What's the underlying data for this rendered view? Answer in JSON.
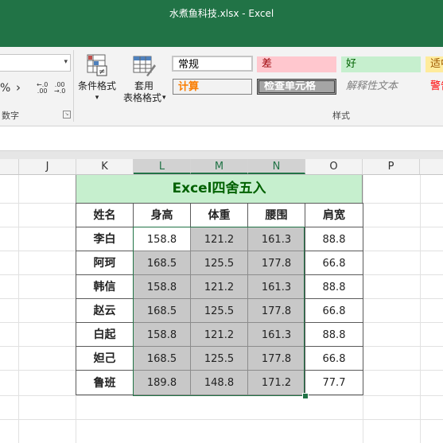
{
  "window": {
    "title": "水煮鱼科技.xlsx - Excel"
  },
  "ribbon": {
    "number_group": {
      "label": "数字",
      "percent": "%",
      "comma": "›",
      "inc_decimal": [
        "←.0",
        ".00"
      ],
      "dec_decimal": [
        ".00",
        "→.0"
      ]
    },
    "conditional_format": {
      "label": "条件格式",
      "arrow": "▾"
    },
    "table_format": {
      "label_line1": "套用",
      "label_line2": "表格格式",
      "arrow": "▾"
    },
    "styles_group": {
      "label": "样式",
      "cells": [
        {
          "name": "normal",
          "label": "常规",
          "fg": "#000000",
          "bg": "#ffffff"
        },
        {
          "name": "bad",
          "label": "差",
          "fg": "#9c0006",
          "bg": "#ffc7ce"
        },
        {
          "name": "good",
          "label": "好",
          "fg": "#006100",
          "bg": "#c6efce"
        },
        {
          "name": "neutral",
          "label": "适中",
          "fg": "#9c5700",
          "bg": "#ffeb9c"
        },
        {
          "name": "calculation",
          "label": "计算",
          "fg": "#fa7d00",
          "bg": "#f2f2f2"
        },
        {
          "name": "check-cell",
          "label": "检查单元格",
          "fg": "#ffffff",
          "bg": "#a5a5a5"
        },
        {
          "name": "explanatory",
          "label": "解释性文本",
          "fg": "#7f7f7f",
          "bg": "#ffffff"
        },
        {
          "name": "warning",
          "label": "警告文本",
          "fg": "#ff0000",
          "bg": "#ffffff"
        }
      ]
    }
  },
  "columns": [
    "J",
    "K",
    "L",
    "M",
    "N",
    "O",
    "P"
  ],
  "selected_columns": [
    "L",
    "M",
    "N"
  ],
  "table": {
    "title": "Excel四舍五入",
    "headers": [
      "姓名",
      "身高",
      "体重",
      "腰围",
      "肩宽"
    ],
    "rows": [
      [
        "李白",
        "158.8",
        "121.2",
        "161.3",
        "88.8"
      ],
      [
        "阿珂",
        "168.5",
        "125.5",
        "177.8",
        "66.8"
      ],
      [
        "韩信",
        "158.8",
        "121.2",
        "161.3",
        "88.8"
      ],
      [
        "赵云",
        "168.5",
        "125.5",
        "177.8",
        "66.8"
      ],
      [
        "白起",
        "158.8",
        "121.2",
        "161.3",
        "88.8"
      ],
      [
        "妲己",
        "168.5",
        "125.5",
        "177.8",
        "66.8"
      ],
      [
        "鲁班",
        "189.8",
        "148.8",
        "171.2",
        "77.7"
      ]
    ]
  },
  "colors": {
    "accent": "#217346",
    "title_bg": "#c6efce",
    "title_fg": "#006100",
    "selection_fill": "#c8c8c8"
  }
}
